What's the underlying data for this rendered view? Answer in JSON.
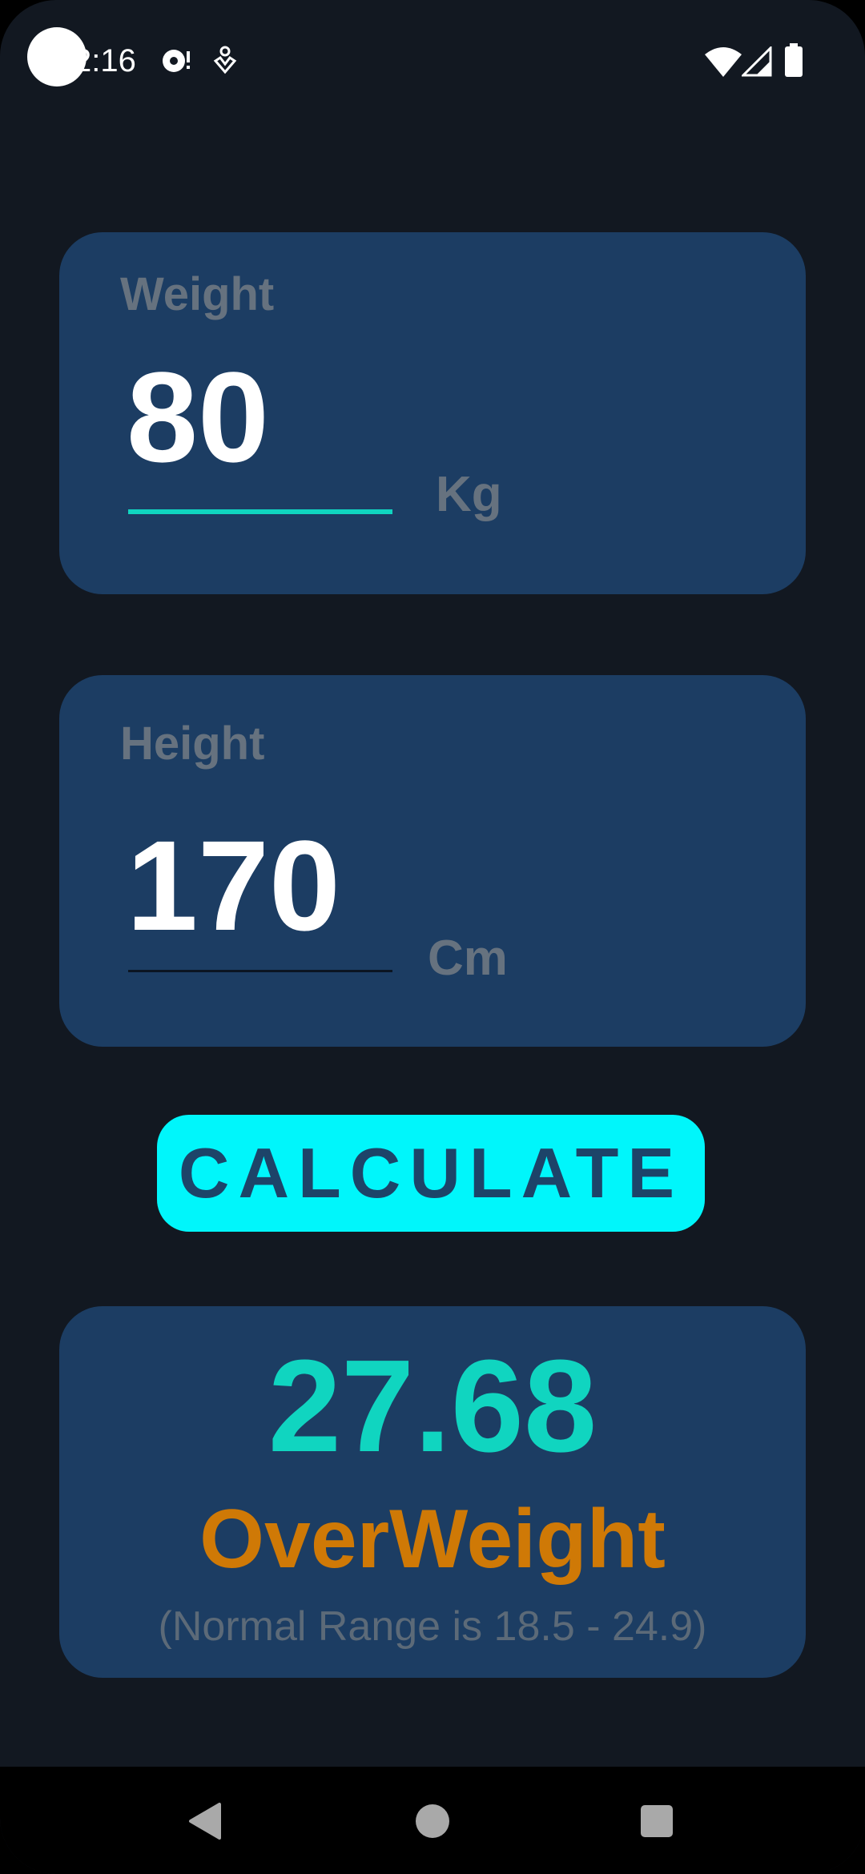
{
  "status_bar": {
    "time": "2:16",
    "icons": [
      "camera-cutout",
      "sync-alert-icon",
      "accessibility-icon",
      "wifi-icon",
      "cell-signal-icon",
      "battery-icon"
    ]
  },
  "weight": {
    "label": "Weight",
    "value": "80",
    "unit": "Kg"
  },
  "height": {
    "label": "Height",
    "value": "170",
    "unit": "Cm"
  },
  "calculate_button": {
    "label": "CALCULATE"
  },
  "result": {
    "bmi": "27.68",
    "category": "OverWeight",
    "range_note": "(Normal Range is 18.5 - 24.9)"
  },
  "nav_bar": {
    "buttons": [
      "back-icon",
      "home-icon",
      "recents-icon"
    ]
  },
  "colors": {
    "background": "#121821",
    "card": "#1c3d63",
    "accent_button": "#00f6fb",
    "bmi_value": "#10d5c0",
    "category": "#cf7906",
    "active_underline": "#10d5c0"
  }
}
